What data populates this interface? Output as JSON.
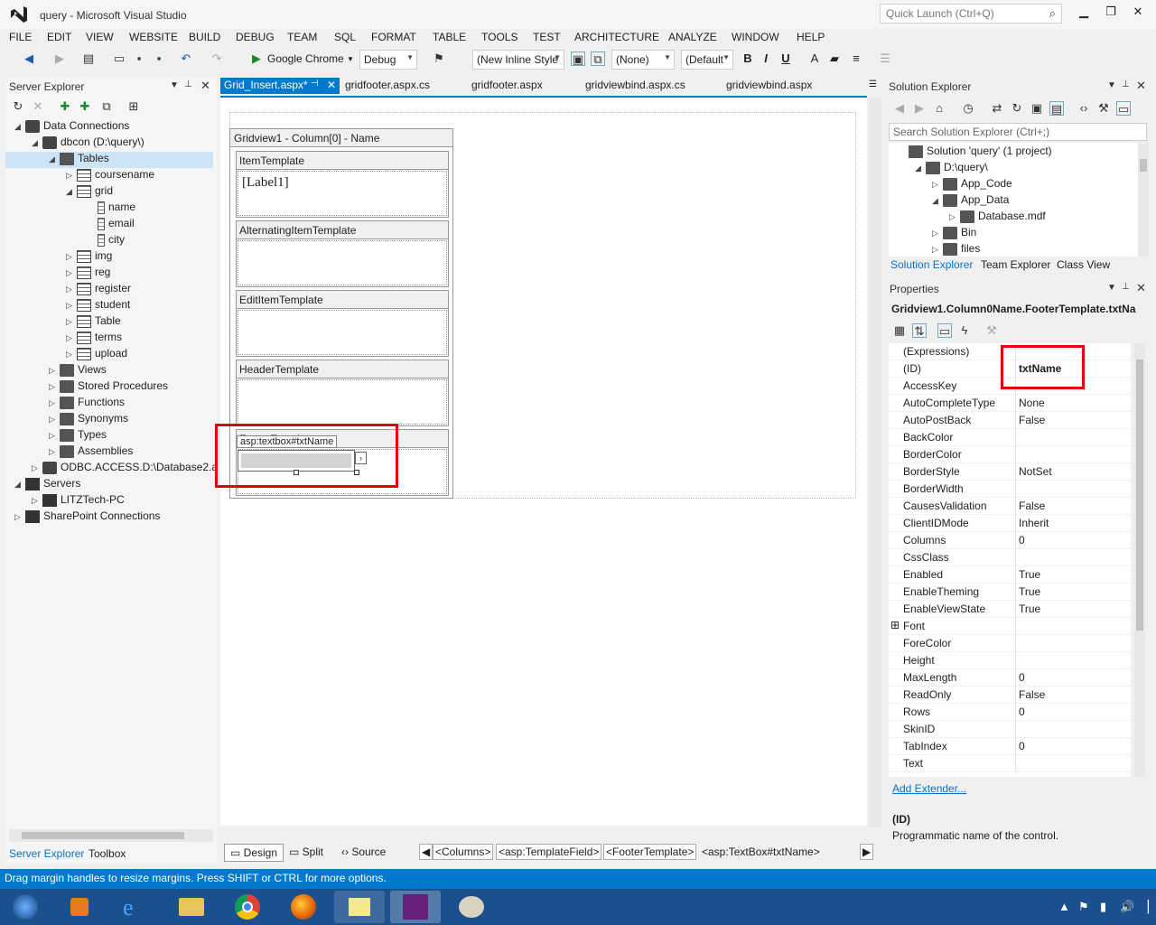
{
  "window": {
    "title": "query - Microsoft Visual Studio",
    "quick_launch_placeholder": "Quick Launch (Ctrl+Q)"
  },
  "menu": [
    "FILE",
    "EDIT",
    "VIEW",
    "WEBSITE",
    "BUILD",
    "DEBUG",
    "TEAM",
    "SQL",
    "FORMAT",
    "TABLE",
    "TOOLS",
    "TEST",
    "ARCHITECTURE",
    "ANALYZE",
    "WINDOW",
    "HELP"
  ],
  "toolbar": {
    "browser": "Google Chrome",
    "config": "Debug",
    "style_combo": "(New Inline Style",
    "target_combo": "(None)",
    "font_combo": "(Default",
    "bold": "B",
    "italic": "I",
    "underline": "U"
  },
  "server_explorer": {
    "title": "Server Explorer",
    "tree": [
      {
        "label": "Data Connections",
        "indent": 0,
        "exp": "◢",
        "icon": "db"
      },
      {
        "label": "dbcon (D:\\query\\)",
        "indent": 1,
        "exp": "◢",
        "icon": "db"
      },
      {
        "label": "Tables",
        "indent": 2,
        "exp": "◢",
        "icon": "folder",
        "selected": true
      },
      {
        "label": "coursename",
        "indent": 3,
        "exp": "▷",
        "icon": "table"
      },
      {
        "label": "grid",
        "indent": 3,
        "exp": "◢",
        "icon": "table"
      },
      {
        "label": "name",
        "indent": 4,
        "exp": "",
        "icon": "col"
      },
      {
        "label": "email",
        "indent": 4,
        "exp": "",
        "icon": "col"
      },
      {
        "label": "city",
        "indent": 4,
        "exp": "",
        "icon": "col"
      },
      {
        "label": "img",
        "indent": 3,
        "exp": "▷",
        "icon": "table"
      },
      {
        "label": "reg",
        "indent": 3,
        "exp": "▷",
        "icon": "table"
      },
      {
        "label": "register",
        "indent": 3,
        "exp": "▷",
        "icon": "table"
      },
      {
        "label": "student",
        "indent": 3,
        "exp": "▷",
        "icon": "table"
      },
      {
        "label": "Table",
        "indent": 3,
        "exp": "▷",
        "icon": "table"
      },
      {
        "label": "terms",
        "indent": 3,
        "exp": "▷",
        "icon": "table"
      },
      {
        "label": "upload",
        "indent": 3,
        "exp": "▷",
        "icon": "table"
      },
      {
        "label": "Views",
        "indent": 2,
        "exp": "▷",
        "icon": "folder"
      },
      {
        "label": "Stored Procedures",
        "indent": 2,
        "exp": "▷",
        "icon": "folder"
      },
      {
        "label": "Functions",
        "indent": 2,
        "exp": "▷",
        "icon": "folder"
      },
      {
        "label": "Synonyms",
        "indent": 2,
        "exp": "▷",
        "icon": "folder"
      },
      {
        "label": "Types",
        "indent": 2,
        "exp": "▷",
        "icon": "folder"
      },
      {
        "label": "Assemblies",
        "indent": 2,
        "exp": "▷",
        "icon": "folder"
      },
      {
        "label": "ODBC.ACCESS.D:\\Database2.a",
        "indent": 1,
        "exp": "▷",
        "icon": "db"
      },
      {
        "label": "Servers",
        "indent": 0,
        "exp": "◢",
        "icon": "server"
      },
      {
        "label": "LITZTech-PC",
        "indent": 1,
        "exp": "▷",
        "icon": "server"
      },
      {
        "label": "SharePoint Connections",
        "indent": 0,
        "exp": "▷",
        "icon": "server"
      }
    ],
    "bottom_tabs": [
      "Server Explorer",
      "Toolbox"
    ]
  },
  "editor": {
    "tabs": [
      "Grid_Insert.aspx*",
      "gridfooter.aspx.cs",
      "gridfooter.aspx",
      "gridviewbind.aspx.cs",
      "gridviewbind.aspx"
    ],
    "gridview_title": "Gridview1 - Column[0] - Name",
    "templates": [
      "ItemTemplate",
      "AlternatingItemTemplate",
      "EditItemTemplate",
      "HeaderTemplate",
      "FooterTemplate"
    ],
    "label_text": "[Label1]",
    "textbox_tag": "asp:textbox#txtName",
    "view_buttons": [
      "Design",
      "Split",
      "Source"
    ],
    "crumbs": [
      "<Columns>",
      "<asp:TemplateField>",
      "<FooterTemplate>",
      "<asp:TextBox#txtName>"
    ]
  },
  "solution_explorer": {
    "title": "Solution Explorer",
    "search_placeholder": "Search Solution Explorer (Ctrl+;)",
    "tree": [
      {
        "label": "Solution 'query' (1 project)",
        "indent": 0,
        "exp": ""
      },
      {
        "label": "D:\\query\\",
        "indent": 1,
        "exp": "◢"
      },
      {
        "label": "App_Code",
        "indent": 2,
        "exp": "▷"
      },
      {
        "label": "App_Data",
        "indent": 2,
        "exp": "◢"
      },
      {
        "label": "Database.mdf",
        "indent": 3,
        "exp": "▷"
      },
      {
        "label": "Bin",
        "indent": 2,
        "exp": "▷"
      },
      {
        "label": "files",
        "indent": 2,
        "exp": "▷"
      }
    ],
    "tabs": [
      "Solution Explorer",
      "Team Explorer",
      "Class View"
    ]
  },
  "properties": {
    "title": "Properties",
    "object": "Gridview1.Column0Name.FooterTemplate.txtNa",
    "rows": [
      {
        "name": "(Expressions)",
        "value": ""
      },
      {
        "name": "(ID)",
        "value": "txtName"
      },
      {
        "name": "AccessKey",
        "value": ""
      },
      {
        "name": "AutoCompleteType",
        "value": "None"
      },
      {
        "name": "AutoPostBack",
        "value": "False"
      },
      {
        "name": "BackColor",
        "value": ""
      },
      {
        "name": "BorderColor",
        "value": ""
      },
      {
        "name": "BorderStyle",
        "value": "NotSet"
      },
      {
        "name": "BorderWidth",
        "value": ""
      },
      {
        "name": "CausesValidation",
        "value": "False"
      },
      {
        "name": "ClientIDMode",
        "value": "Inherit"
      },
      {
        "name": "Columns",
        "value": "0"
      },
      {
        "name": "CssClass",
        "value": ""
      },
      {
        "name": "Enabled",
        "value": "True"
      },
      {
        "name": "EnableTheming",
        "value": "True"
      },
      {
        "name": "EnableViewState",
        "value": "True"
      },
      {
        "name": "Font",
        "value": ""
      },
      {
        "name": "ForeColor",
        "value": ""
      },
      {
        "name": "Height",
        "value": ""
      },
      {
        "name": "MaxLength",
        "value": "0"
      },
      {
        "name": "ReadOnly",
        "value": "False"
      },
      {
        "name": "Rows",
        "value": "0"
      },
      {
        "name": "SkinID",
        "value": ""
      },
      {
        "name": "TabIndex",
        "value": "0"
      },
      {
        "name": "Text",
        "value": ""
      }
    ],
    "add_extender": "Add Extender...",
    "desc_title": "(ID)",
    "desc_text": "Programmatic name of the control."
  },
  "status": "Drag margin handles to resize margins. Press SHIFT or CTRL for more options.",
  "colors": {
    "accent": "#007acc",
    "highlight": "#e0000a"
  }
}
